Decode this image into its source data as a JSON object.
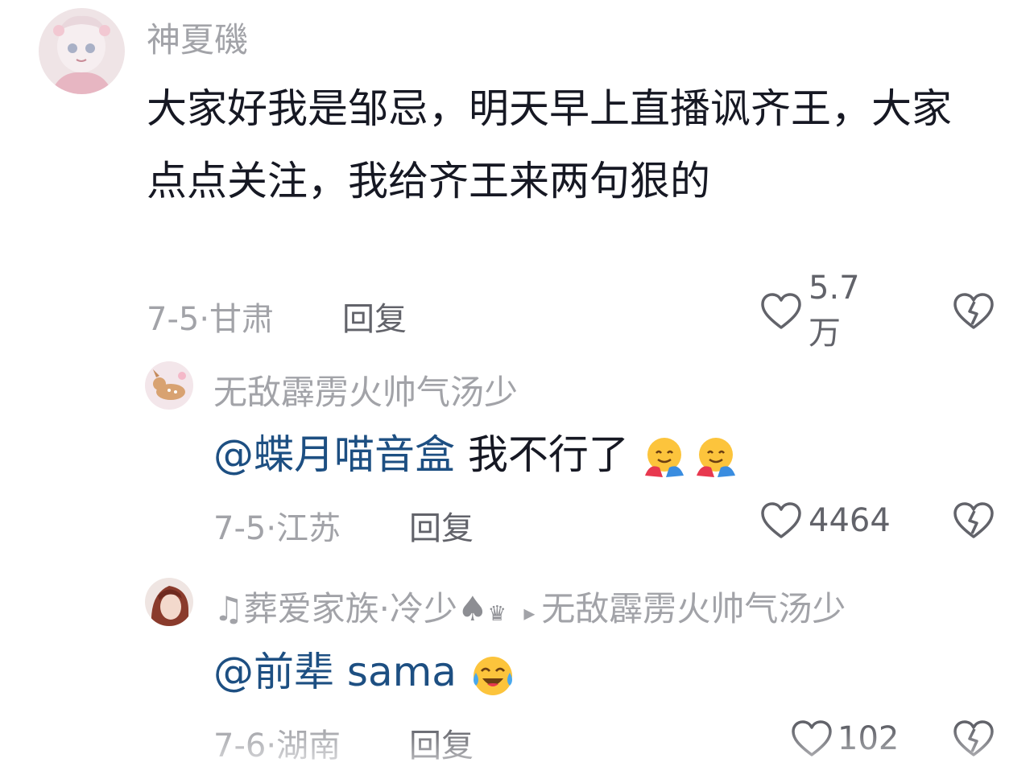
{
  "comments": [
    {
      "username": "神夏磯",
      "text": "大家好我是邹忌，明天早上直播讽齐王，大家点点关注，我给齐王来两句狠的",
      "date": "7-5·",
      "location": "甘肃",
      "reply_label": "回复",
      "likes": "5.7万"
    },
    {
      "username": "无敌霹雳火帅气汤少",
      "mention": "@蝶月喵音盒",
      "text": " 我不行了",
      "emojis": [
        "hug-emoji",
        "hug-emoji"
      ],
      "date": "7-5·",
      "location": "江苏",
      "reply_label": "回复",
      "likes": "4464"
    },
    {
      "username_prefix": "♫葬爱家族·冷少",
      "reply_arrow": "▸",
      "reply_to": "无敌霹雳火帅气汤少",
      "mention": "@前辈 sama",
      "text": "",
      "emojis": [
        "crying-laughing-emoji"
      ],
      "date": "7-6·",
      "location": "湖南",
      "reply_label": "回复",
      "likes": "102"
    }
  ],
  "colors": {
    "text": "#161823",
    "secondary": "#a2a3a8",
    "action": "#62636a",
    "mention": "#1d4f82"
  }
}
